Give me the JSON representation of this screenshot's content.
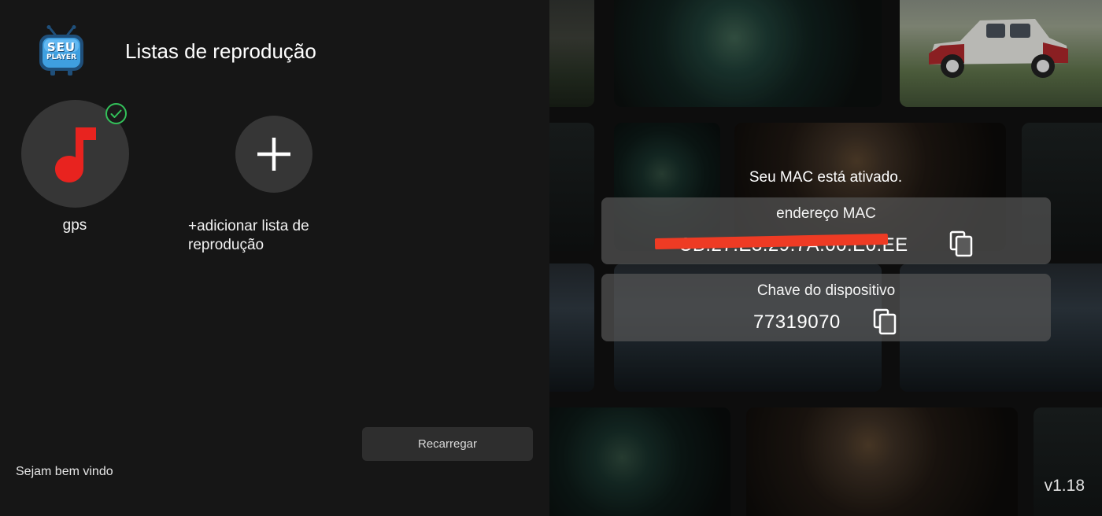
{
  "app": {
    "logo_text_top": "SEU",
    "logo_text_bottom": "PLAYER",
    "title": "Listas de reprodução",
    "welcome": "Sejam bem vindo",
    "version": "v1.18"
  },
  "playlists": {
    "items": [
      {
        "label": "gps",
        "icon": "music-note-icon",
        "selected": true,
        "icon_color": "#e8231f"
      }
    ],
    "add_label": "+adicionar lista de reprodução",
    "add_icon": "plus-icon"
  },
  "actions": {
    "reload_label": "Recarregar"
  },
  "device": {
    "status_text": "Seu MAC está ativado.",
    "mac_label": "endereço MAC",
    "mac_value": "CB:27:E3:29:7A:00:E0:EE",
    "key_label": "Chave do dispositivo",
    "key_value": "77319070",
    "copy_icon": "copy-icon"
  },
  "colors": {
    "accent_check": "#33c25a",
    "redaction": "#ee3b24",
    "music_icon": "#e8231f"
  }
}
